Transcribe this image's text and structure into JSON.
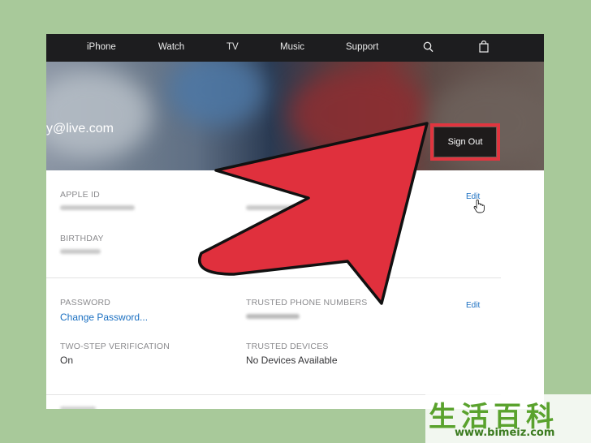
{
  "nav": {
    "items": [
      "iPhone",
      "Watch",
      "TV",
      "Music",
      "Support"
    ],
    "search_icon": "search-icon",
    "bag_icon": "shopping-bag-icon"
  },
  "hero": {
    "email": "y@live.com",
    "sign_out": "Sign Out"
  },
  "account": {
    "apple_id_label": "APPLE ID",
    "birthday_label": "BIRTHDAY",
    "edit_label": "Edit"
  },
  "security": {
    "password_label": "PASSWORD",
    "change_password": "Change Password...",
    "two_step_label": "TWO-STEP VERIFICATION",
    "two_step_value": "On",
    "trusted_phone_label": "TRUSTED PHONE NUMBERS",
    "trusted_devices_label": "TRUSTED DEVICES",
    "trusted_devices_value": "No Devices Available",
    "edit_label": "Edit"
  },
  "watermark": {
    "chars": "生活百科",
    "url": "www.bimeiz.com"
  },
  "colors": {
    "highlight_red": "#e0353f",
    "link_blue": "#1a6fc1",
    "nav_bg": "#1d1d1f"
  }
}
